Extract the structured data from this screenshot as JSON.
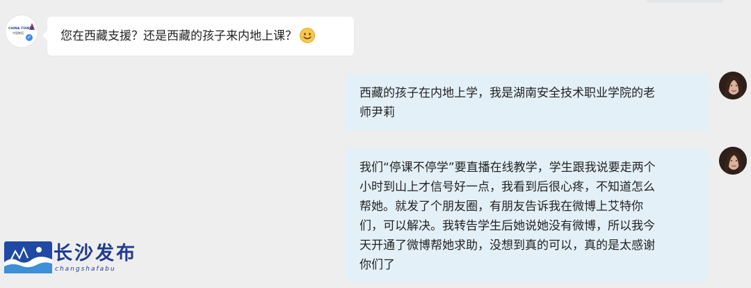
{
  "contact": {
    "avatar_brand": "CHINA TOWER",
    "avatar_brand_cn": "中国铁塔",
    "verified": true
  },
  "messages": [
    {
      "side": "left",
      "text": "您在西藏支援？还是西藏的孩子来内地上课？",
      "emoji": "smile-emoji"
    },
    {
      "side": "right",
      "lines": [
        "西藏的孩子在内地上学，我是湖南安全技术职业学院的老",
        "师尹莉"
      ]
    },
    {
      "side": "right",
      "lines": [
        "我们“停课不停学”要直播在线教学，学生跟我说要走两个",
        "小时到山上才信号好一点，我看到后很心疼，不知道怎么",
        "帮她。就发了个朋友圈，有朋友告诉我在微博上艾特你",
        "们，可以解决。我转告学生后她说她没有微博，所以我今",
        "天开通了微博帮她求助，没想到真的可以，真的是太感谢",
        "你们了"
      ]
    }
  ],
  "watermark": {
    "title": "长沙发布",
    "subtitle": "changshafabu"
  },
  "colors": {
    "background": "#eeeeee",
    "bubble_left": "#ffffff",
    "bubble_right": "#e4f0f8",
    "text": "#222222",
    "watermark": "#1d3c8f",
    "verified": "#3d8ee6"
  }
}
